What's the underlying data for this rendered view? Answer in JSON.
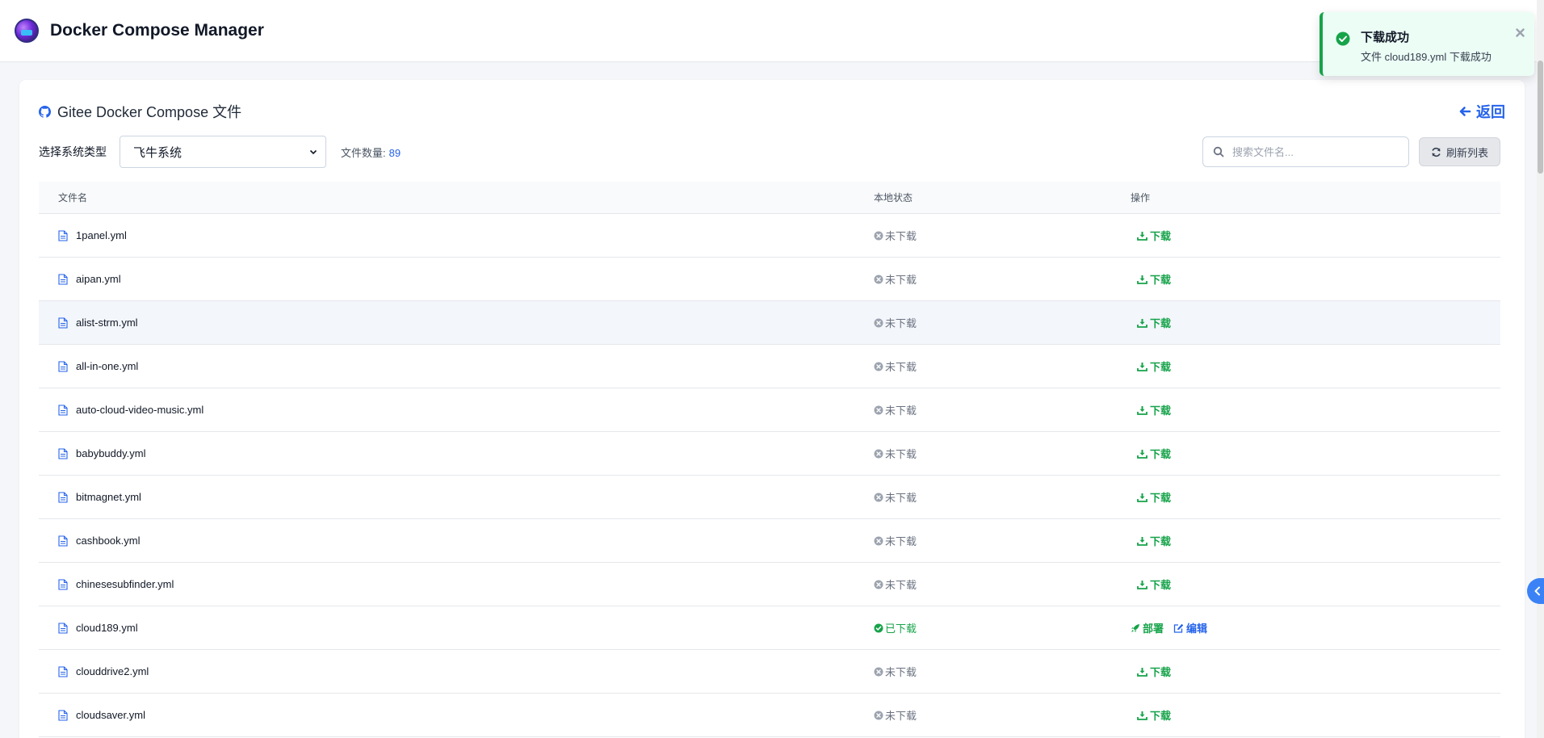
{
  "app": {
    "title": "Docker Compose Manager"
  },
  "card": {
    "title": "Gitee Docker Compose 文件",
    "back_label": "返回"
  },
  "filters": {
    "system_label": "选择系统类型",
    "system_selected": "飞牛系统",
    "count_label": "文件数量:",
    "count_value": "89",
    "search_placeholder": "搜索文件名...",
    "refresh_label": "刷新列表"
  },
  "table": {
    "headers": {
      "name": "文件名",
      "status": "本地状态",
      "action": "操作"
    },
    "rows": [
      {
        "name": "1panel.yml",
        "status": "未下载",
        "action": "下载"
      },
      {
        "name": "aipan.yml",
        "status": "未下载",
        "action": "下载"
      },
      {
        "name": "alist-strm.yml",
        "status": "未下载",
        "action": "下载"
      },
      {
        "name": "all-in-one.yml",
        "status": "未下载",
        "action": "下载"
      },
      {
        "name": "auto-cloud-video-music.yml",
        "status": "未下载",
        "action": "下载"
      },
      {
        "name": "babybuddy.yml",
        "status": "未下载",
        "action": "下载"
      },
      {
        "name": "bitmagnet.yml",
        "status": "未下载",
        "action": "下载"
      },
      {
        "name": "cashbook.yml",
        "status": "未下载",
        "action": "下载"
      },
      {
        "name": "chinesesubfinder.yml",
        "status": "未下载",
        "action": "下载"
      },
      {
        "name": "cloud189.yml",
        "status": "已下载",
        "deploy": "部署",
        "edit": "编辑"
      },
      {
        "name": "clouddrive2.yml",
        "status": "未下载",
        "action": "下载"
      },
      {
        "name": "cloudsaver.yml",
        "status": "未下载",
        "action": "下载"
      }
    ]
  },
  "toast": {
    "title": "下载成功",
    "message": "文件 cloud189.yml 下载成功"
  },
  "colors": {
    "accent": "#2563eb",
    "success": "#16a34a",
    "muted": "#6b7280"
  }
}
